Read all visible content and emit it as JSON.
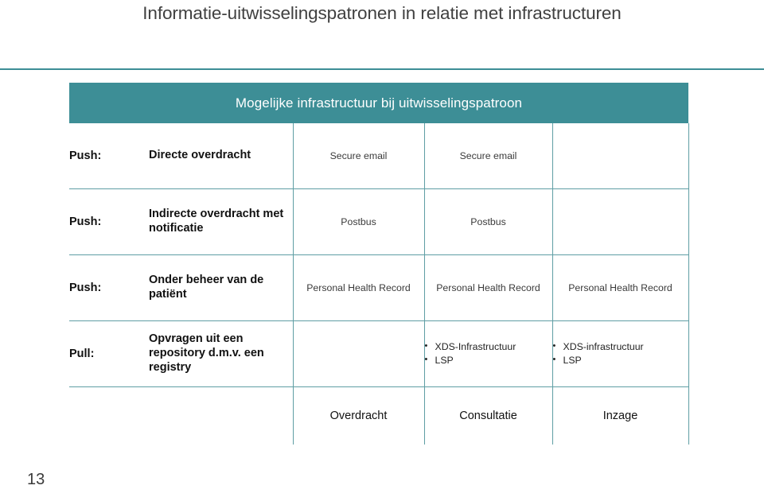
{
  "slide": {
    "title": "Informatie-uitwisselingspatronen in relatie met infrastructuren",
    "page_number": "13",
    "accent_color": "#3d8e96",
    "grid_line_color": "#5f9ea4",
    "title_color": "#404040"
  },
  "matrix": {
    "header": "Mogelijke infrastructuur bij uitwisselingspatroon",
    "rows": [
      {
        "kind": "Push:",
        "description": "Directe overdracht",
        "cols": [
          {
            "type": "text",
            "value": "Secure email"
          },
          {
            "type": "text",
            "value": "Secure email"
          },
          {
            "type": "empty",
            "value": ""
          }
        ]
      },
      {
        "kind": "Push:",
        "description": "Indirecte overdracht met notificatie",
        "cols": [
          {
            "type": "text",
            "value": "Postbus"
          },
          {
            "type": "text",
            "value": "Postbus"
          },
          {
            "type": "empty",
            "value": ""
          }
        ]
      },
      {
        "kind": "Push:",
        "description": "Onder beheer van de patiënt",
        "cols": [
          {
            "type": "text",
            "value": "Personal Health Record"
          },
          {
            "type": "text",
            "value": "Personal Health Record"
          },
          {
            "type": "text",
            "value": "Personal Health Record"
          }
        ]
      },
      {
        "kind": "Pull:",
        "description": "Opvragen uit een repository d.m.v. een registry",
        "cols": [
          {
            "type": "empty",
            "value": ""
          },
          {
            "type": "bullets",
            "items": [
              "XDS-Infrastructuur",
              "LSP"
            ]
          },
          {
            "type": "bullets",
            "items": [
              "XDS-infrastructuur",
              "LSP"
            ]
          }
        ]
      }
    ],
    "footer": {
      "kind": "",
      "description": "",
      "labels": [
        "Overdracht",
        "Consultatie",
        "Inzage"
      ]
    }
  }
}
